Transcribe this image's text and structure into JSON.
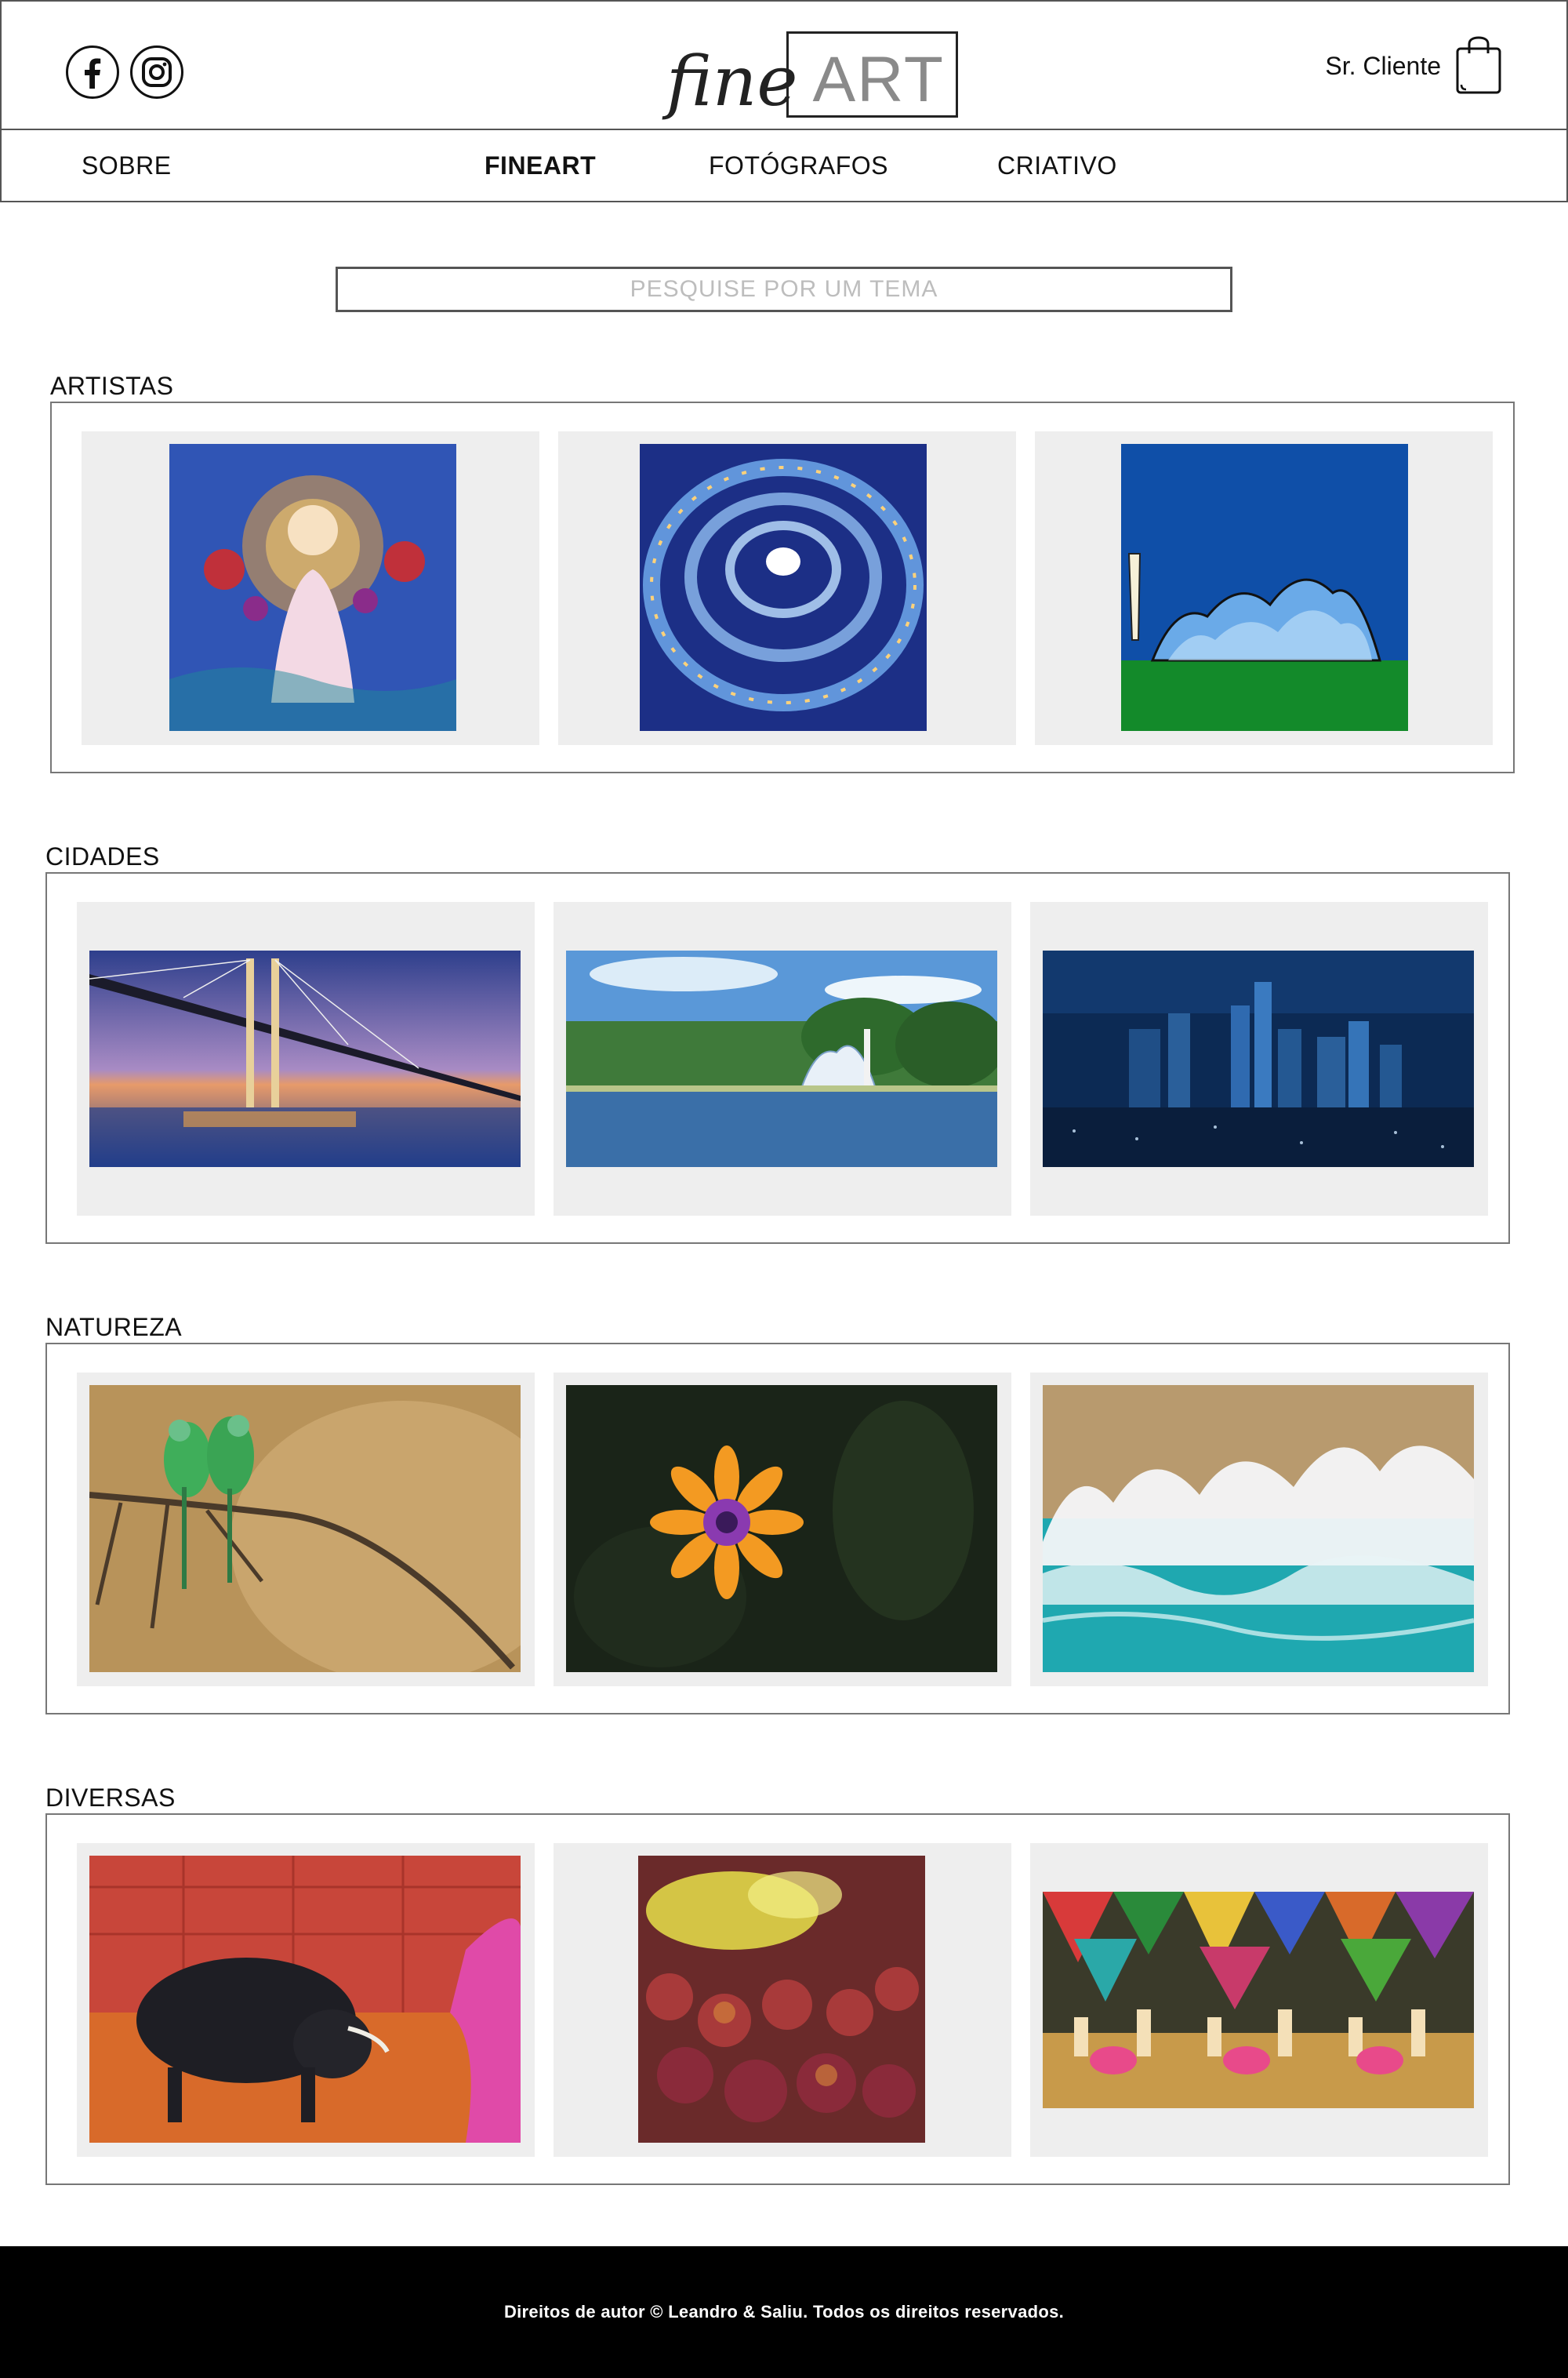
{
  "header": {
    "logo_fine": "fine",
    "logo_art": "ART",
    "client_name": "Sr. Cliente",
    "icons": [
      "facebook-icon",
      "instagram-icon",
      "shopping-bag-icon"
    ]
  },
  "nav": {
    "items": [
      {
        "label": "SOBRE"
      },
      {
        "label": "FINEART",
        "active": true
      },
      {
        "label": "FOTÓGRAFOS"
      },
      {
        "label": "CRIATIVO"
      }
    ]
  },
  "search": {
    "placeholder": "PESQUISE POR UM TEMA"
  },
  "sections": [
    {
      "title": "ARTISTAS",
      "images": [
        "madonna-painting",
        "spiral-painting",
        "church-illustration"
      ]
    },
    {
      "title": "CIDADES",
      "images": [
        "bridge-sunset",
        "lake-church",
        "city-night"
      ]
    },
    {
      "title": "NATUREZA",
      "images": [
        "birds-branch",
        "orange-flower",
        "ocean-waves"
      ]
    },
    {
      "title": "DIVERSAS",
      "images": [
        "bullfight",
        "color-festival",
        "festa-junina"
      ]
    }
  ],
  "footer": {
    "text": "Direitos de autor © Leandro & Saliu. Todos os direitos reservados."
  },
  "colors": {
    "card_bg": "#eeeeee",
    "footer_bg": "#000000",
    "border": "#555555",
    "placeholder": "#bdbdbd"
  }
}
